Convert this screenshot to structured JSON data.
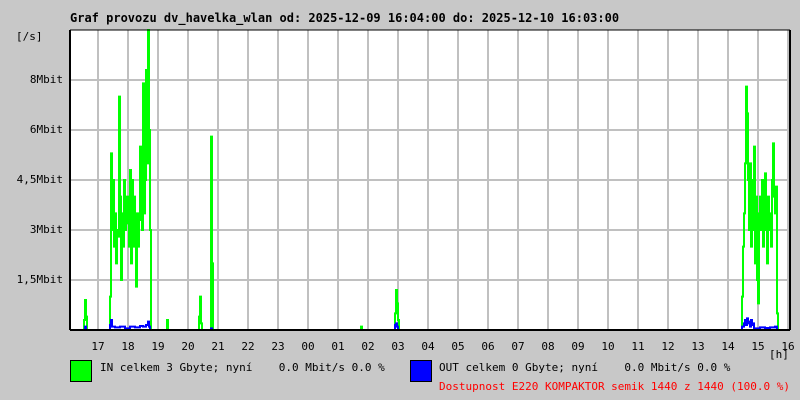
{
  "chart_data": {
    "type": "line",
    "title": "Graf provozu dv_havelka_wlan od: 2025-12-09 16:04:00 do: 2025-12-10 16:03:00",
    "ylabel": "[/s]",
    "xlabel": "[h]",
    "x_units": "minutes since 2025-12-09 16:04",
    "ylim_mbit": [
      0,
      9
    ],
    "y_ticks": [
      {
        "v": 1.5,
        "label": "1,5Mbit"
      },
      {
        "v": 3,
        "label": "3Mbit"
      },
      {
        "v": 4.5,
        "label": "4,5Mbit"
      },
      {
        "v": 6,
        "label": "6Mbit"
      },
      {
        "v": 7.5,
        "label": "8Mbit"
      }
    ],
    "x_ticks": [
      "17",
      "18",
      "19",
      "20",
      "21",
      "22",
      "23",
      "00",
      "01",
      "02",
      "03",
      "04",
      "05",
      "06",
      "07",
      "08",
      "09",
      "10",
      "11",
      "12",
      "13",
      "14",
      "15",
      "16"
    ],
    "grid": true,
    "series": [
      {
        "name": "IN",
        "color": "#00ff00",
        "points": [
          [
            28,
            0.3
          ],
          [
            30,
            0.9
          ],
          [
            32,
            0.4
          ],
          [
            34,
            0
          ],
          [
            78,
            0
          ],
          [
            80,
            1.0
          ],
          [
            82,
            5.3
          ],
          [
            84,
            3
          ],
          [
            86,
            4.5
          ],
          [
            88,
            2.5
          ],
          [
            90,
            3.5
          ],
          [
            92,
            2
          ],
          [
            94,
            3
          ],
          [
            96,
            2.8
          ],
          [
            98,
            7.0
          ],
          [
            100,
            4
          ],
          [
            102,
            1.5
          ],
          [
            104,
            3.5
          ],
          [
            106,
            2.5
          ],
          [
            108,
            4.5
          ],
          [
            110,
            3
          ],
          [
            112,
            3.2
          ],
          [
            114,
            4.0
          ],
          [
            116,
            3.5
          ],
          [
            118,
            2.5
          ],
          [
            120,
            4.8
          ],
          [
            122,
            2.0
          ],
          [
            124,
            4.5
          ],
          [
            126,
            2.5
          ],
          [
            128,
            4
          ],
          [
            130,
            3.5
          ],
          [
            132,
            1.3
          ],
          [
            134,
            3.5
          ],
          [
            136,
            2.5
          ],
          [
            138,
            3.3
          ],
          [
            140,
            5.5
          ],
          [
            142,
            4.5
          ],
          [
            144,
            3
          ],
          [
            146,
            7.4
          ],
          [
            148,
            3.5
          ],
          [
            150,
            4.5
          ],
          [
            152,
            7.8
          ],
          [
            154,
            5
          ],
          [
            156,
            9.0
          ],
          [
            158,
            6
          ],
          [
            160,
            3.0
          ],
          [
            162,
            0
          ],
          [
            192,
            0
          ],
          [
            194,
            0.3
          ],
          [
            196,
            0
          ],
          [
            256,
            0
          ],
          [
            258,
            0.4
          ],
          [
            260,
            1.0
          ],
          [
            262,
            0.2
          ],
          [
            264,
            0
          ],
          [
            280,
            0
          ],
          [
            282,
            5.8
          ],
          [
            284,
            2
          ],
          [
            286,
            0
          ],
          [
            580,
            0
          ],
          [
            582,
            0.1
          ],
          [
            584,
            0
          ],
          [
            648,
            0
          ],
          [
            650,
            0.5
          ],
          [
            652,
            1.2
          ],
          [
            654,
            0.8
          ],
          [
            656,
            0.3
          ],
          [
            658,
            0
          ],
          [
            1342,
            0
          ],
          [
            1344,
            1.0
          ],
          [
            1346,
            2.5
          ],
          [
            1348,
            3.5
          ],
          [
            1350,
            5.0
          ],
          [
            1352,
            7.3
          ],
          [
            1354,
            6.5
          ],
          [
            1356,
            4.5
          ],
          [
            1358,
            3.0
          ],
          [
            1360,
            5.0
          ],
          [
            1362,
            2.5
          ],
          [
            1364,
            4.5
          ],
          [
            1366,
            3.0
          ],
          [
            1368,
            5.5
          ],
          [
            1370,
            2.0
          ],
          [
            1372,
            4.0
          ],
          [
            1374,
            1.5
          ],
          [
            1376,
            0.8
          ],
          [
            1378,
            3.5
          ],
          [
            1380,
            4.0
          ],
          [
            1382,
            3.0
          ],
          [
            1384,
            4.5
          ],
          [
            1386,
            2.5
          ],
          [
            1388,
            3.5
          ],
          [
            1390,
            4.7
          ],
          [
            1392,
            3.0
          ],
          [
            1394,
            2.0
          ],
          [
            1396,
            4.0
          ],
          [
            1398,
            3.0
          ],
          [
            1400,
            3.5
          ],
          [
            1402,
            2.5
          ],
          [
            1404,
            4.5
          ],
          [
            1406,
            5.6
          ],
          [
            1408,
            4.0
          ],
          [
            1410,
            3.5
          ],
          [
            1412,
            4.3
          ],
          [
            1414,
            0.5
          ],
          [
            1416,
            0
          ]
        ]
      },
      {
        "name": "OUT",
        "color": "#0000ff",
        "points": [
          [
            28,
            0
          ],
          [
            30,
            0.1
          ],
          [
            32,
            0
          ],
          [
            78,
            0
          ],
          [
            80,
            0.15
          ],
          [
            82,
            0.3
          ],
          [
            84,
            0.1
          ],
          [
            90,
            0.08
          ],
          [
            100,
            0.1
          ],
          [
            110,
            0.05
          ],
          [
            120,
            0.1
          ],
          [
            130,
            0.08
          ],
          [
            140,
            0.12
          ],
          [
            146,
            0.1
          ],
          [
            152,
            0.15
          ],
          [
            156,
            0.25
          ],
          [
            158,
            0.1
          ],
          [
            160,
            0
          ],
          [
            282,
            0.05
          ],
          [
            284,
            0
          ],
          [
            648,
            0
          ],
          [
            650,
            0.15
          ],
          [
            652,
            0.2
          ],
          [
            654,
            0.1
          ],
          [
            656,
            0
          ],
          [
            1342,
            0
          ],
          [
            1344,
            0.1
          ],
          [
            1348,
            0.2
          ],
          [
            1350,
            0.3
          ],
          [
            1352,
            0.15
          ],
          [
            1354,
            0.35
          ],
          [
            1356,
            0.2
          ],
          [
            1358,
            0.25
          ],
          [
            1360,
            0.1
          ],
          [
            1362,
            0.3
          ],
          [
            1364,
            0.15
          ],
          [
            1366,
            0.2
          ],
          [
            1368,
            0.05
          ],
          [
            1374,
            0.05
          ],
          [
            1380,
            0.08
          ],
          [
            1390,
            0.06
          ],
          [
            1400,
            0.08
          ],
          [
            1410,
            0.1
          ],
          [
            1414,
            0
          ]
        ]
      }
    ]
  },
  "legend": {
    "in_text": "IN celkem 3 Gbyte; nyní    0.0 Mbit/s 0.0 %",
    "out_text": "OUT celkem 0 Gbyte; nyní    0.0 Mbit/s 0.0 %",
    "availability": "Dostupnost E220 KOMPAKTOR semik 1440 z 1440 (100.0 %)",
    "availability_color": "#ff0000"
  }
}
